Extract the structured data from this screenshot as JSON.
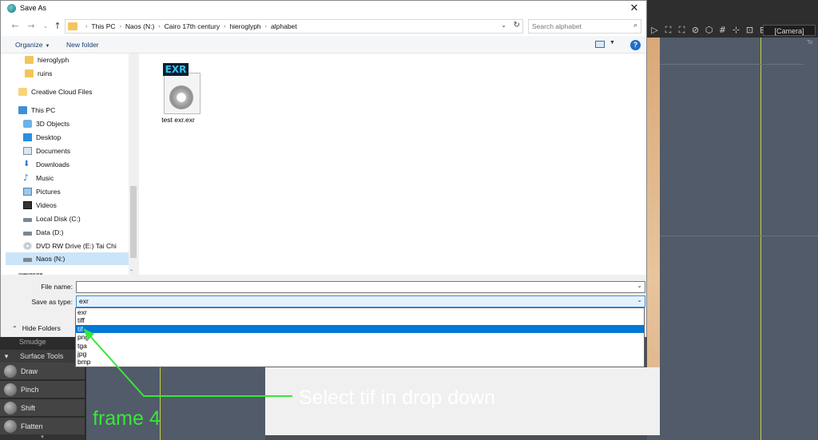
{
  "dialog": {
    "title": "Save As",
    "close_glyph": "✕",
    "nav": {
      "back": "←",
      "forward": "→",
      "recent": "⌄",
      "up": "↑"
    },
    "breadcrumb": [
      "This PC",
      "Naos (N:)",
      "Cairo 17th century",
      "hieroglyph",
      "alphabet"
    ],
    "breadcrumb_sep": "›",
    "search_placeholder": "Search alphabet",
    "toolbar": {
      "organize": "Organize",
      "new_folder": "New folder",
      "help": "?"
    },
    "nav_pane": [
      {
        "label": "hieroglyph",
        "icon": "folder-icon"
      },
      {
        "label": "ruins",
        "icon": "folder-icon"
      },
      {
        "label": "Creative Cloud Files",
        "icon": "folder-icon"
      },
      {
        "label": "This PC",
        "icon": "computer-icon"
      },
      {
        "label": "3D Objects",
        "icon": "cube-icon"
      },
      {
        "label": "Desktop",
        "icon": "desktop-icon"
      },
      {
        "label": "Documents",
        "icon": "document-icon"
      },
      {
        "label": "Downloads",
        "icon": "download-icon"
      },
      {
        "label": "Music",
        "icon": "music-icon"
      },
      {
        "label": "Pictures",
        "icon": "picture-icon"
      },
      {
        "label": "Videos",
        "icon": "video-icon"
      },
      {
        "label": "Local Disk (C:)",
        "icon": "disk-icon"
      },
      {
        "label": "Data (D:)",
        "icon": "disk-icon"
      },
      {
        "label": "DVD RW Drive (E:) Tai Chi",
        "icon": "dvd-icon"
      },
      {
        "label": "Naos (N:)",
        "icon": "disk-icon",
        "selected": true
      }
    ],
    "nav_pane_clipped": "Network",
    "files": [
      {
        "name": "test exr.exr",
        "badge": "EXR",
        "icon": "exr-file-icon"
      }
    ],
    "file_name_label": "File name:",
    "file_name_value": "",
    "save_type_label": "Save as type:",
    "save_type_value": "exr",
    "save_type_options": [
      "exr",
      "tiff",
      "tif",
      "png",
      "tga",
      "jpg",
      "bmp"
    ],
    "save_type_selected": "tif",
    "hide_folders": "Hide Folders"
  },
  "app": {
    "camera_label": "[Camera]",
    "viewport_label": "To",
    "smudge_label": "Smudge",
    "panel_title": "Surface Tools",
    "tools": [
      "Draw",
      "Pinch",
      "Shift",
      "Flatten"
    ],
    "toolbar_glyphs": [
      "▷",
      "⛶",
      "⛶",
      "⊘",
      "⬡",
      "#",
      "⊹",
      "⊡",
      "⊞"
    ]
  },
  "annotations": {
    "callout": "Select tif in drop down",
    "frame": "frame 4",
    "arrow_color": "#39e639"
  }
}
